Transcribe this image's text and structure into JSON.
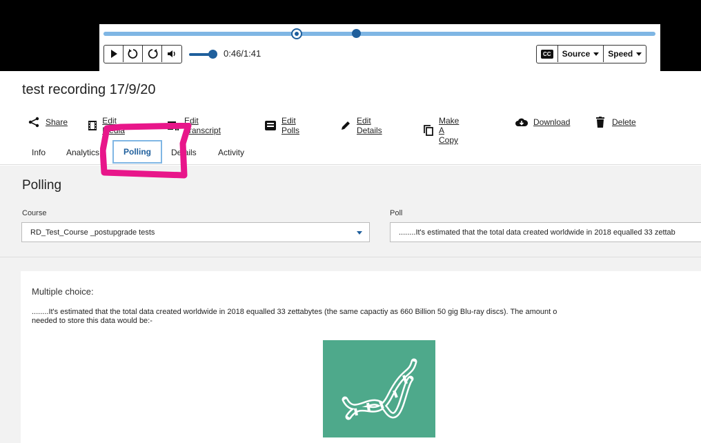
{
  "player": {
    "time": "0:46/1:41",
    "progress_fraction": 0.35,
    "volume_fraction": 0.8,
    "cc_label": "CC",
    "source_label": "Source",
    "speed_label": "Speed"
  },
  "page": {
    "title": "test recording 17/9/20"
  },
  "actions": [
    {
      "label": "Share",
      "icon": "share-icon"
    },
    {
      "label": "Edit Media",
      "icon": "film-icon"
    },
    {
      "label": "Edit Transcript",
      "icon": "transcript-icon"
    },
    {
      "label": "Edit Polls",
      "icon": "poll-icon"
    },
    {
      "label": "Edit Details",
      "icon": "pencil-icon"
    },
    {
      "label": "Make A Copy",
      "icon": "copy-icon"
    },
    {
      "label": "Download",
      "icon": "cloud-download-icon"
    },
    {
      "label": "Delete",
      "icon": "trash-icon"
    }
  ],
  "tabs": {
    "info": "Info",
    "analytics": "Analytics",
    "polling": "Polling",
    "details": "Details",
    "activity": "Activity"
  },
  "polling": {
    "heading": "Polling",
    "course_label": "Course",
    "course_value": "RD_Test_Course _postupgrade tests",
    "poll_label": "Poll",
    "poll_value": "........It's estimated that the total data created worldwide in 2018 equalled 33 zettab",
    "question_type": "Multiple choice:",
    "question_line1": "........It's estimated that the total data created worldwide in 2018 equalled 33 zettabytes (the same capactiy as 660 Billion 50 gig Blu-ray discs). The amount o",
    "question_line2": "needed to store this data would be:-"
  },
  "colors": {
    "accent": "#1f5f9c",
    "progress": "#7fb6e4",
    "annotation": "#e8168a",
    "image_bg": "#4ea98b"
  }
}
